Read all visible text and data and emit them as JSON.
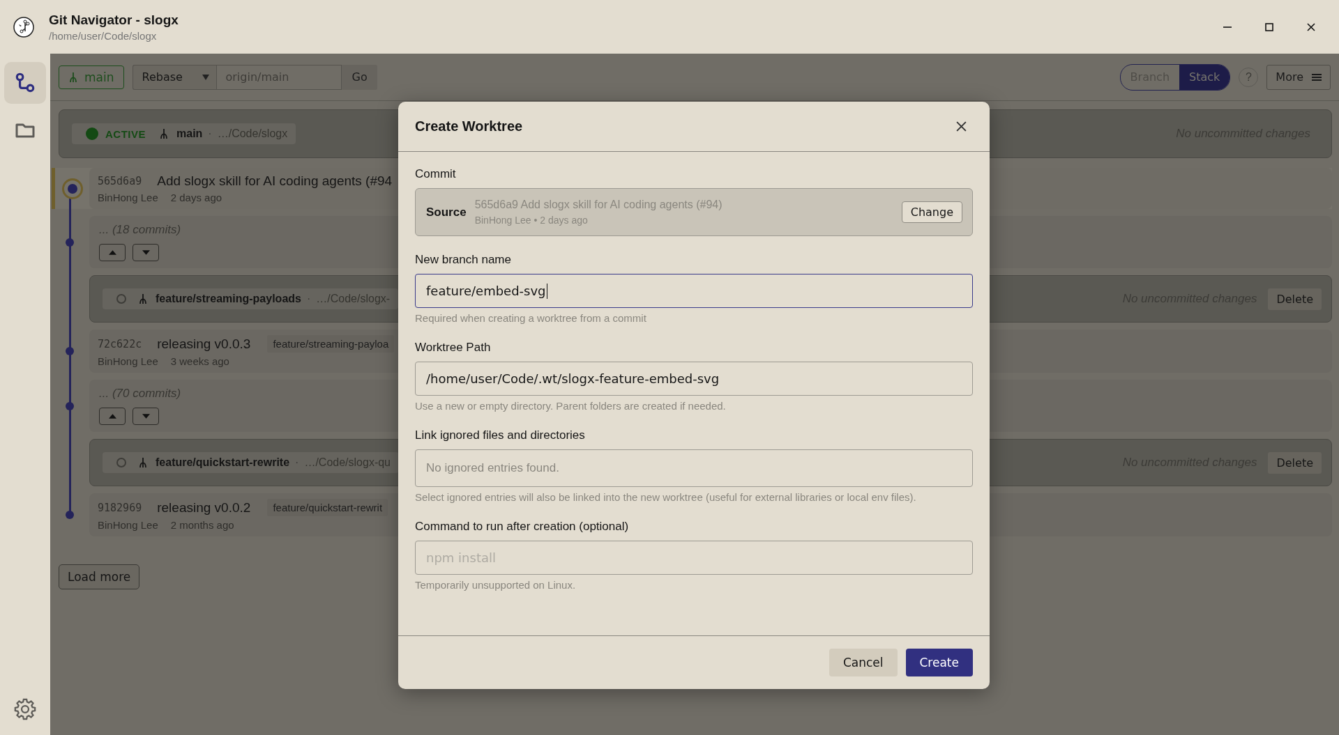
{
  "window": {
    "title": "Git Navigator - slogx",
    "path": "/home/user/Code/slogx"
  },
  "sidebar": {
    "items": [
      {
        "kind": "graph",
        "selected": true
      },
      {
        "kind": "folder",
        "selected": false
      }
    ]
  },
  "toolbar": {
    "branch": "main",
    "mode": "Rebase",
    "target_placeholder": "origin/main",
    "go": "Go",
    "views": [
      {
        "label": "Branch",
        "selected": false
      },
      {
        "label": "Stack",
        "selected": true
      }
    ],
    "help": "?",
    "more": "More"
  },
  "active_worktree": {
    "active": true,
    "status": "ACTIVE",
    "branch": "main",
    "separator": "·",
    "path": "…/Code/slogx",
    "changes": "No uncommitted changes"
  },
  "timeline": [
    {
      "kind": "commit",
      "selected": true,
      "hash": "565d6a9",
      "message": "Add slogx skill for AI coding agents (#94",
      "author": "BinHong Lee",
      "time": "2 days ago"
    },
    {
      "kind": "collapsed",
      "label": "... (18 commits)"
    },
    {
      "kind": "worktree",
      "active": false,
      "branch": "feature/streaming-payloads",
      "separator": "·",
      "path": "…/Code/slogx-",
      "changes": "No uncommitted changes",
      "action": "Delete"
    },
    {
      "kind": "commit",
      "selected": false,
      "hash": "72c622c",
      "message": "releasing v0.0.3",
      "tag": "feature/streaming-payloa",
      "author": "BinHong Lee",
      "time": "3 weeks ago"
    },
    {
      "kind": "collapsed",
      "label": "... (70 commits)"
    },
    {
      "kind": "worktree",
      "active": false,
      "branch": "feature/quickstart-rewrite",
      "separator": "·",
      "path": "…/Code/slogx-qu",
      "changes": "No uncommitted changes",
      "action": "Delete"
    },
    {
      "kind": "commit",
      "selected": false,
      "hash": "9182969",
      "message": "releasing v0.0.2",
      "tag": "feature/quickstart-rewrit",
      "author": "BinHong Lee",
      "time": "2 months ago"
    }
  ],
  "load_more": "Load more",
  "dialog": {
    "title": "Create Worktree",
    "commit_label": "Commit",
    "source": {
      "label": "Source",
      "summary": "565d6a9 Add slogx skill for AI coding agents (#94)",
      "meta": "BinHong Lee • 2 days ago",
      "action": "Change"
    },
    "fields": [
      {
        "kind": "text",
        "label": "New branch name",
        "value": "feature/embed-svg",
        "focused": true,
        "hint": "Required when creating a worktree from a commit"
      },
      {
        "kind": "text",
        "label": "Worktree Path",
        "value": "/home/user/Code/.wt/slogx-feature-embed-svg",
        "focused": false,
        "hint": "Use a new or empty directory. Parent folders are created if needed."
      },
      {
        "kind": "list",
        "label": "Link ignored files and directories",
        "empty": "No ignored entries found.",
        "hint": "Select ignored entries will also be linked into the new worktree (useful for external libraries or local env files)."
      },
      {
        "kind": "text",
        "label": "Command to run after creation (optional)",
        "placeholder": "npm install",
        "focused": false,
        "hint": "Temporarily unsupported on Linux."
      }
    ],
    "cancel": "Cancel",
    "create": "Create"
  }
}
